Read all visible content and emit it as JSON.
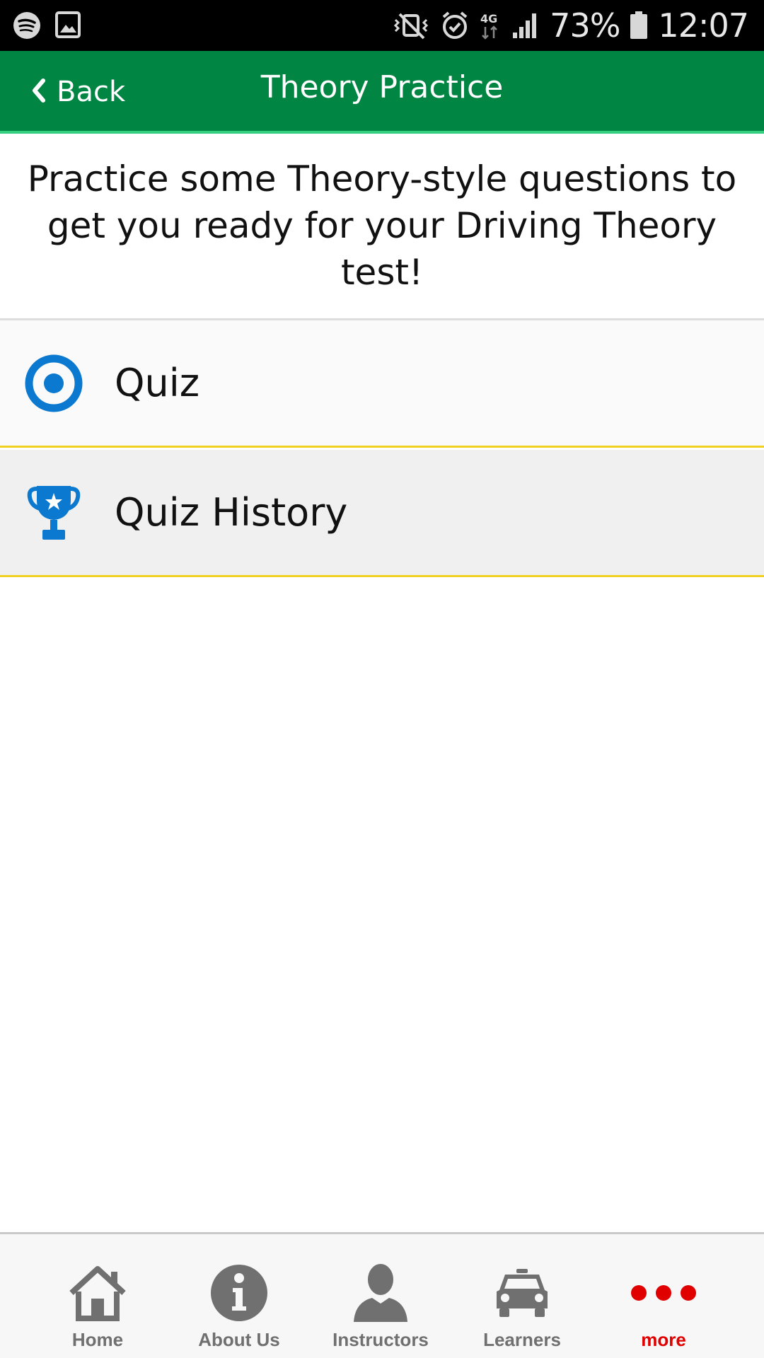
{
  "status_bar": {
    "battery_percent": "73%",
    "time": "12:07",
    "network": "4G",
    "icons": [
      "spotify-icon",
      "gallery-icon",
      "vibrate-mute-icon",
      "alarm-icon",
      "network-4g-icon",
      "signal-icon",
      "battery-icon"
    ]
  },
  "header": {
    "back_label": "Back",
    "title": "Theory Practice",
    "color": "#018542"
  },
  "intro_text": "Practice some Theory-style questions to get you ready for your Driving Theory test!",
  "list": {
    "items": [
      {
        "label": "Quiz",
        "icon": "target-icon"
      },
      {
        "label": "Quiz History",
        "icon": "trophy-icon"
      }
    ],
    "accent": "#f0d020"
  },
  "bottom_nav": {
    "items": [
      {
        "label": "Home",
        "icon": "home-icon"
      },
      {
        "label": "About Us",
        "icon": "info-icon"
      },
      {
        "label": "Instructors",
        "icon": "person-icon"
      },
      {
        "label": "Learners",
        "icon": "car-icon"
      },
      {
        "label": "more",
        "icon": "more-dots-icon",
        "active": true
      }
    ],
    "active_color": "#e00000"
  }
}
